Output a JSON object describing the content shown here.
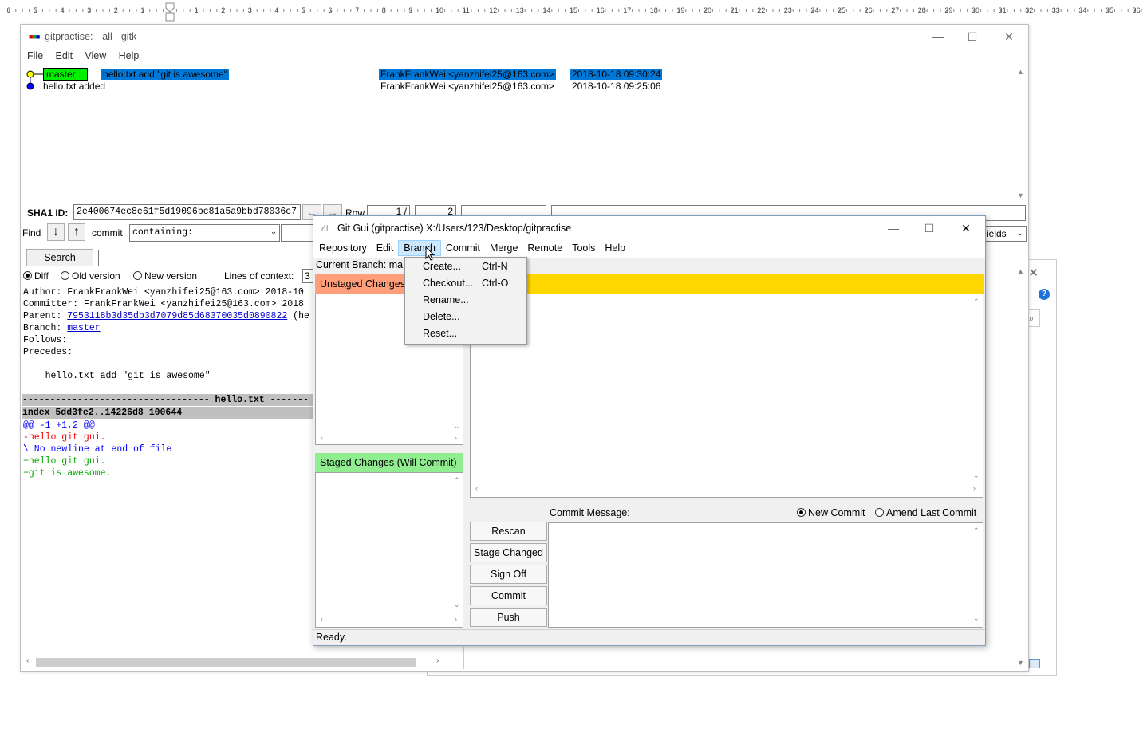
{
  "ruler": {
    "labels": [
      "6",
      "5",
      "4",
      "3",
      "2",
      "1",
      "1",
      "2",
      "3",
      "4",
      "5",
      "6",
      "7",
      "8",
      "9",
      "10",
      "11",
      "12",
      "13",
      "14",
      "15",
      "16",
      "17",
      "18",
      "19",
      "20",
      "21",
      "22",
      "23",
      "24",
      "25",
      "26",
      "27",
      "28",
      "29",
      "30",
      "31",
      "32",
      "33",
      "34",
      "35",
      "36"
    ]
  },
  "gitk": {
    "title": "gitpractise: --all - gitk",
    "menu": [
      "File",
      "Edit",
      "View",
      "Help"
    ],
    "commits": [
      {
        "branch": "master",
        "message": "hello.txt add \"git is awesome\"",
        "author": "FrankFrankWei <yanzhifei25@163.com>",
        "date": "2018-10-18 09:30:24"
      },
      {
        "message": "hello.txt added",
        "author": "FrankFrankWei <yanzhifei25@163.com>",
        "date": "2018-10-18 09:25:06"
      }
    ],
    "sha1_label": "SHA1 ID:",
    "sha1_value": "2e400674ec8e61f5d19096bc81a5a9bbd78036c7",
    "row_label": "Row",
    "row_current": "1 /",
    "row_total": "2",
    "find_label": "Find",
    "commit_label": "commit",
    "containing": "containing:",
    "fields_label": "ields",
    "search_button": "Search",
    "diff_label": "Diff",
    "old_version_label": "Old version",
    "new_version_label": "New version",
    "lines_of_context_label": "Lines of context:",
    "lines_of_context_value": "3",
    "details": {
      "author": "Author: FrankFrankWei <yanzhifei25@163.com>  2018-10",
      "committer": "Committer: FrankFrankWei <yanzhifei25@163.com>  2018",
      "parent_label": "Parent: ",
      "parent_hash": "7953118b3d35db3d7079d85d68370035d0890822",
      "parent_suffix": " (he",
      "branch_label": "Branch: ",
      "branch_value": "master",
      "follows": "Follows:",
      "precedes": "Precedes:",
      "message": "    hello.txt add \"git is awesome\""
    },
    "diff": {
      "file_header": "---------------------------------- hello.txt -------",
      "index": "index 5dd3fe2..14226d8 100644",
      "hunk": "@@ -1 +1,2 @@",
      "removed": "-hello git gui.",
      "nonewline": "\\ No newline at end of file",
      "added1": "+hello git gui.",
      "added2": "+git is awesome."
    }
  },
  "gitgui": {
    "title": "Git Gui (gitpractise) X:/Users/123/Desktop/gitpractise",
    "menu": [
      "Repository",
      "Edit",
      "Branch",
      "Commit",
      "Merge",
      "Remote",
      "Tools",
      "Help"
    ],
    "current_branch": "Current Branch: ma",
    "unstaged_header": "Unstaged Changes",
    "staged_header": "Staged Changes (Will Commit)",
    "commit_message_label": "Commit Message:",
    "new_commit_label": "New Commit",
    "amend_label": "Amend Last Commit",
    "buttons": [
      "Rescan",
      "Stage Changed",
      "Sign Off",
      "Commit",
      "Push"
    ],
    "status": "Ready.",
    "colors": {
      "unstaged": "#ff9e7a",
      "staged": "#90ee90",
      "diff_header": "#ffd700"
    }
  },
  "branch_menu": {
    "items": [
      {
        "label": "Create...",
        "shortcut": "Ctrl-N"
      },
      {
        "label": "Checkout...",
        "shortcut": "Ctrl-O"
      },
      {
        "label": "Rename...",
        "shortcut": ""
      },
      {
        "label": "Delete...",
        "shortcut": ""
      },
      {
        "label": "Reset...",
        "shortcut": ""
      }
    ]
  }
}
